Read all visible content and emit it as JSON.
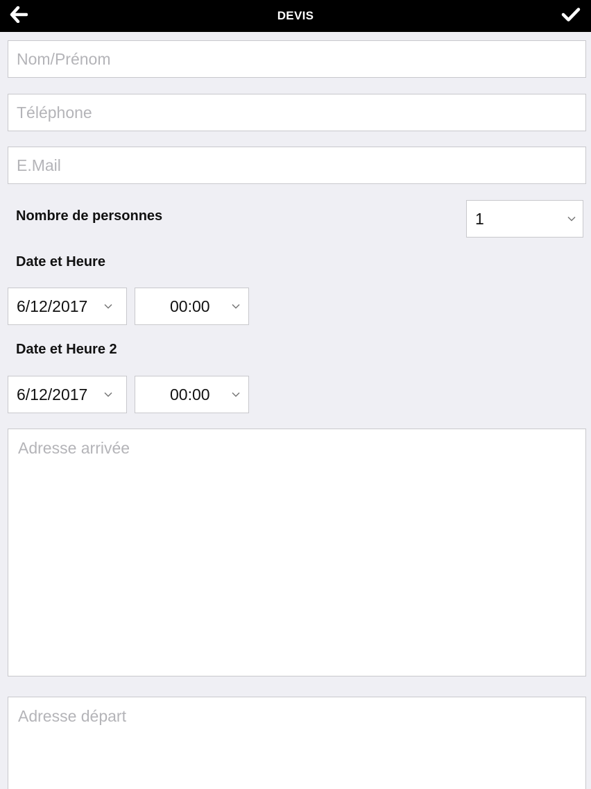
{
  "header": {
    "title": "DEVIS",
    "back_icon": "arrow-left-icon",
    "confirm_icon": "checkmark-icon"
  },
  "form": {
    "name_placeholder": "Nom/Prénom",
    "phone_placeholder": "Téléphone",
    "email_placeholder": "E.Mail",
    "persons_label": "Nombre de personnes",
    "persons_value": "1",
    "datetime1_label": "Date et Heure",
    "date1_value": "6/12/2017",
    "time1_value": "00:00",
    "datetime2_label": "Date et Heure 2",
    "date2_value": "6/12/2017",
    "time2_value": "00:00",
    "arrival_placeholder": "Adresse arrivée",
    "departure_placeholder": "Adresse départ"
  }
}
